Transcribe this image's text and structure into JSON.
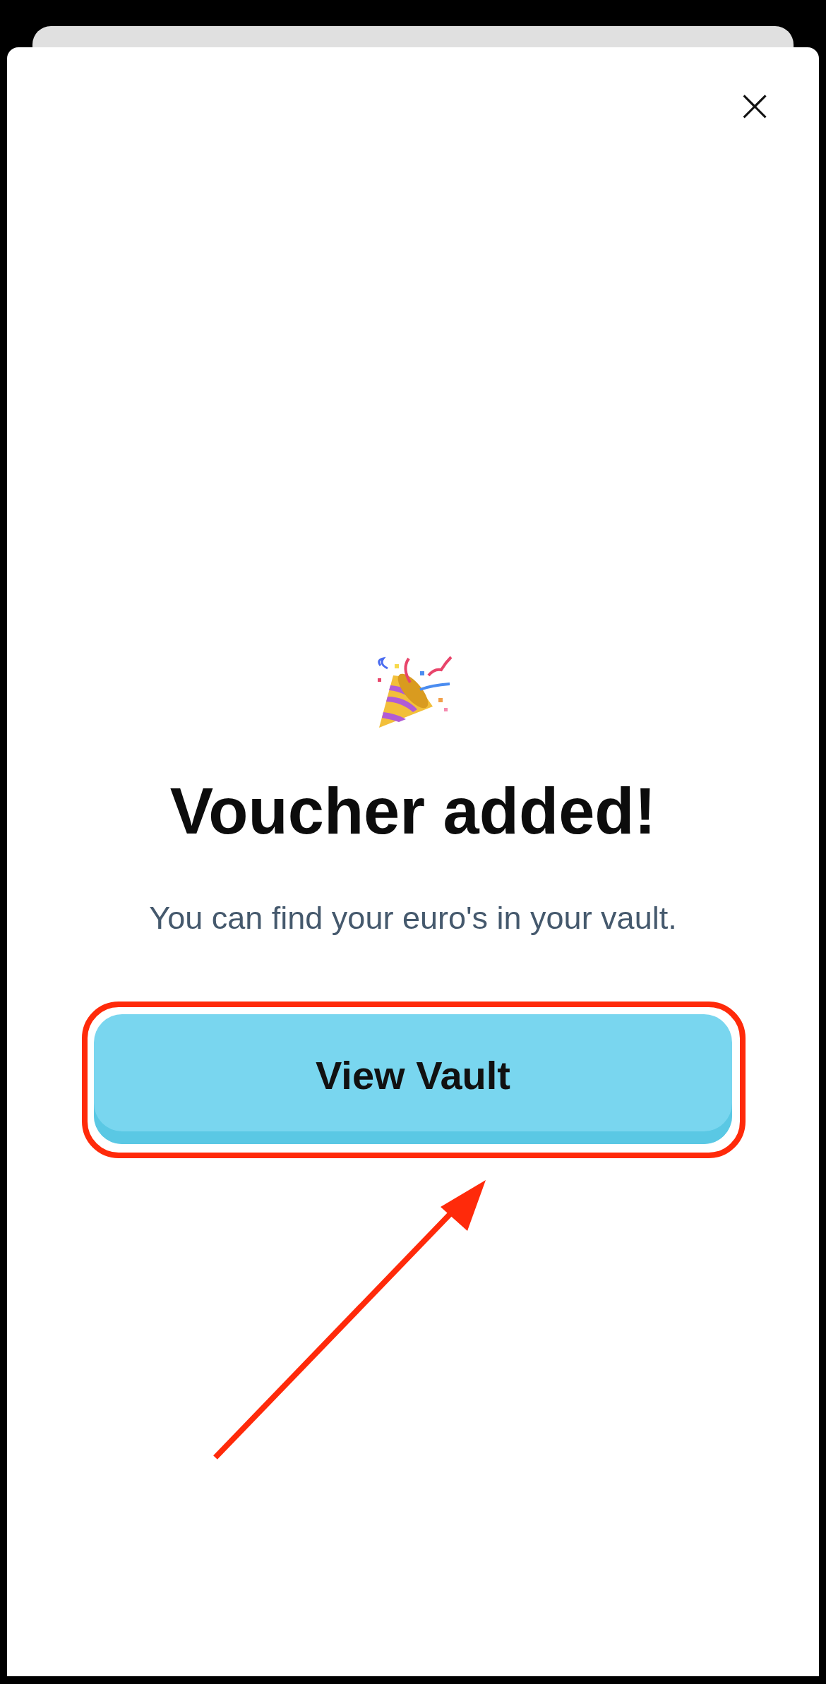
{
  "close_button": {
    "label": "×"
  },
  "title": "Voucher added!",
  "message": "You can find your euro's in your vault.",
  "primary_button": {
    "label": "View Vault",
    "highlighted": true
  },
  "pointer_arrow": true
}
